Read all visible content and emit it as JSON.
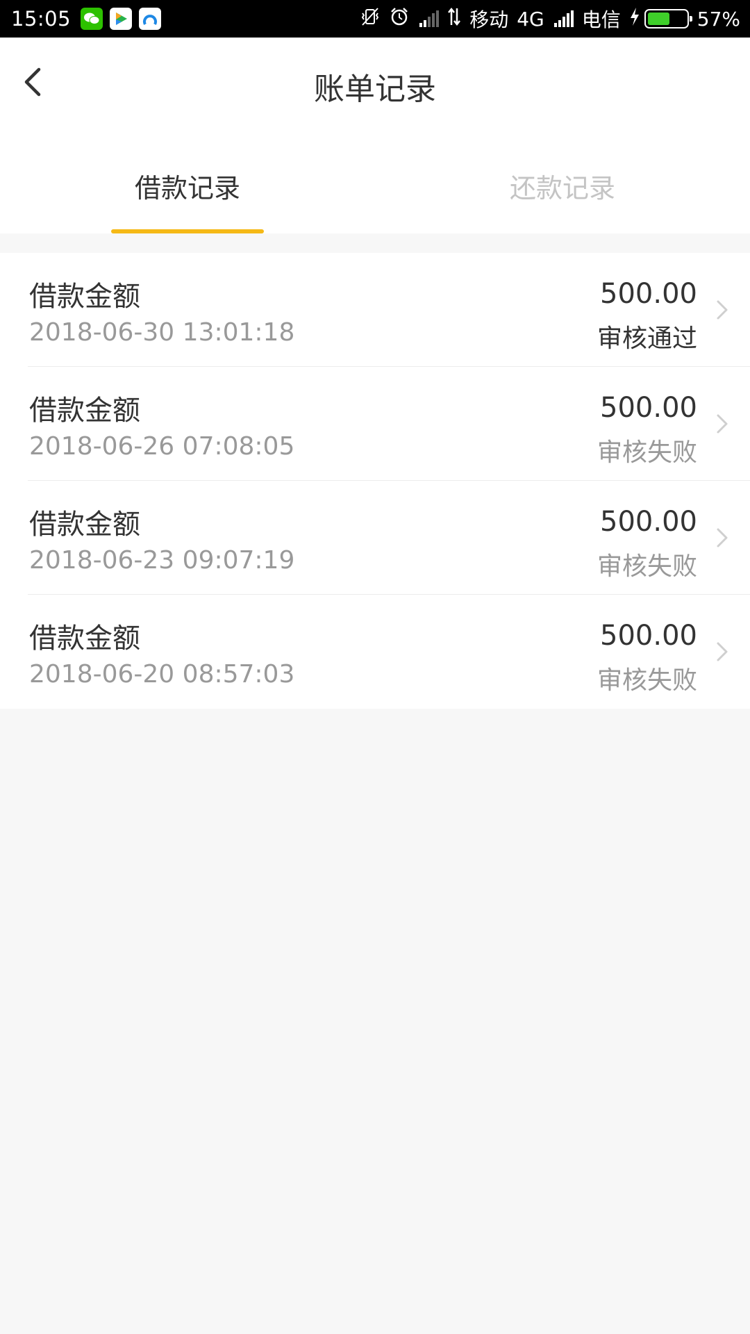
{
  "statusbar": {
    "time": "15:05",
    "carrier1": "移动",
    "network": "4G",
    "carrier2": "电信",
    "battery": "57%",
    "battery_level": 0.57
  },
  "header": {
    "title": "账单记录"
  },
  "tabs": [
    {
      "label": "借款记录",
      "active": true
    },
    {
      "label": "还款记录",
      "active": false
    }
  ],
  "records": [
    {
      "title": "借款金额",
      "date": "2018-06-30 13:01:18",
      "amount": "500.00",
      "status": "审核通过"
    },
    {
      "title": "借款金额",
      "date": "2018-06-26 07:08:05",
      "amount": "500.00",
      "status": "审核失败"
    },
    {
      "title": "借款金额",
      "date": "2018-06-23 09:07:19",
      "amount": "500.00",
      "status": "审核失败"
    },
    {
      "title": "借款金额",
      "date": "2018-06-20 08:57:03",
      "amount": "500.00",
      "status": "审核失败"
    }
  ],
  "colors": {
    "accent": "#f5b916",
    "battery": "#3fcf2a"
  }
}
